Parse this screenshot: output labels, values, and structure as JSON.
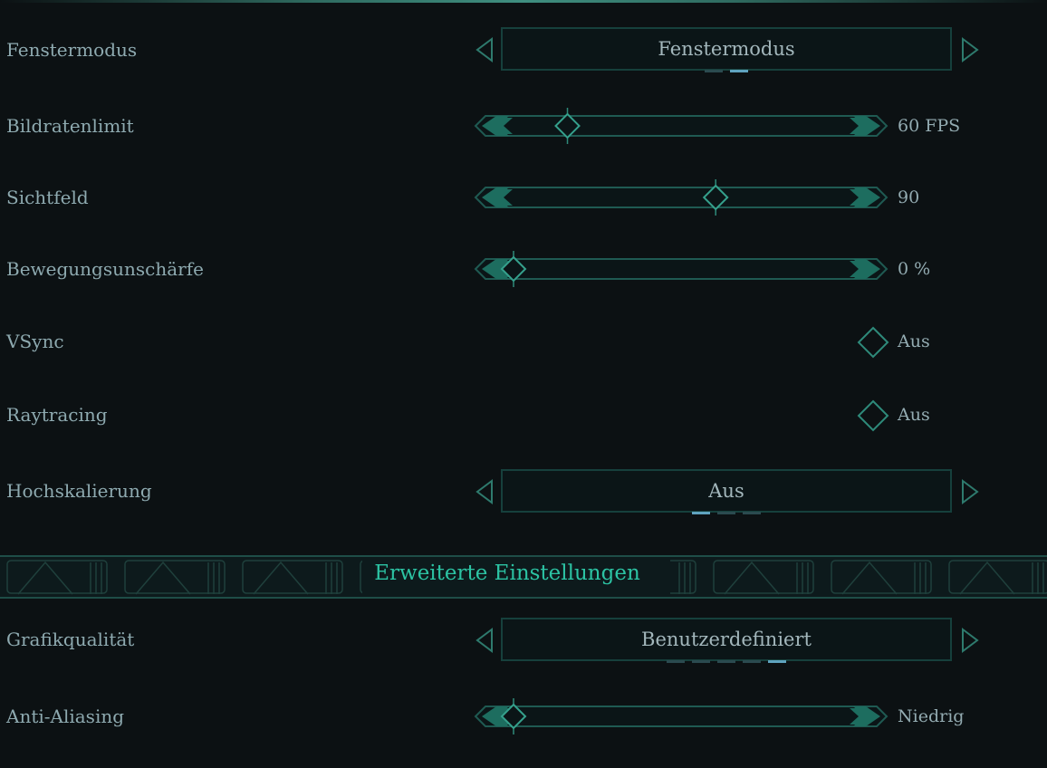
{
  "colors": {
    "background": "#0c1113",
    "accent": "#2cc3a3",
    "label": "#8eaab0",
    "active_dot": "#5fa3bf"
  },
  "settings": {
    "window_mode": {
      "label": "Fenstermodus",
      "value": "Fenstermodus",
      "option_count": 2,
      "selected_index": 1
    },
    "framerate": {
      "label": "Bildratenlimit",
      "value": "60 FPS",
      "fraction": 0.16
    },
    "fov": {
      "label": "Sichtfeld",
      "value": "90",
      "fraction": 0.6
    },
    "motion_blur": {
      "label": "Bewegungsunschärfe",
      "value": "0 %",
      "fraction": 0.0
    },
    "vsync": {
      "label": "VSync",
      "value": "Aus"
    },
    "raytracing": {
      "label": "Raytracing",
      "value": "Aus"
    },
    "upscaling": {
      "label": "Hochskalierung",
      "value": "Aus",
      "option_count": 3,
      "selected_index": 0
    }
  },
  "section": {
    "title": "Erweiterte Einstellungen"
  },
  "advanced": {
    "quality": {
      "label": "Grafikqualität",
      "value": "Benutzerdefiniert",
      "option_count": 5,
      "selected_index": 4
    },
    "antialiasing": {
      "label": "Anti-Aliasing",
      "value": "Niedrig",
      "fraction": 0.0
    }
  },
  "icons": {
    "prev": "triangle-left-icon",
    "next": "triangle-right-icon",
    "slider_end": "double-chevron-icon",
    "thumb": "diamond-icon",
    "toggle": "diamond-toggle-icon"
  }
}
